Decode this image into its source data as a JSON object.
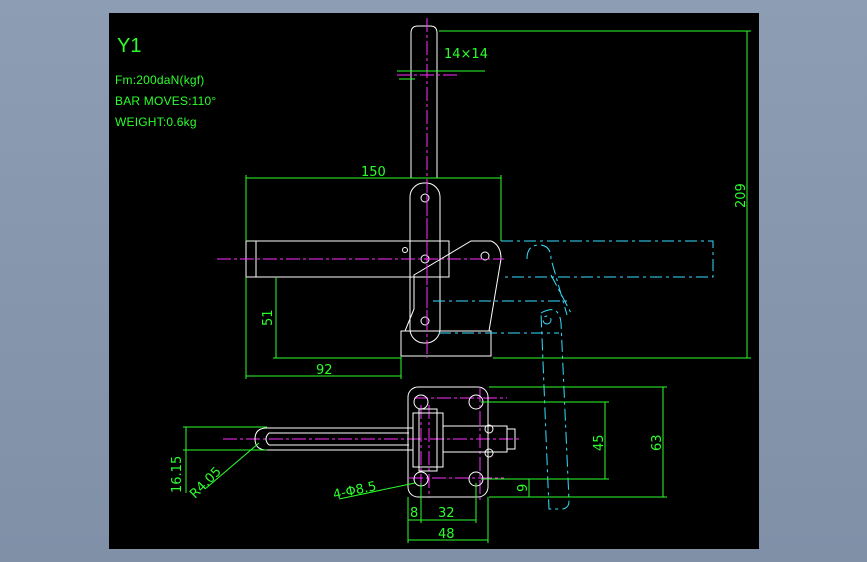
{
  "drawing": {
    "title": "Y1",
    "notes": [
      "Fm:200daN(kgf)",
      "BAR MOVES:110°",
      "WEIGHT:0.6kg"
    ],
    "dimensions": {
      "square": "14×14",
      "width_150": "150",
      "height_209": "209",
      "height_51": "51",
      "width_92": "92",
      "height_45": "45",
      "height_63": "63",
      "height_9": "9",
      "height_1615": "16.15",
      "radius": "R4.05",
      "holes": "4-Φ8.5",
      "width_8": "8",
      "width_32": "32",
      "width_48": "48"
    }
  },
  "colors": {
    "background": "#000000",
    "outline": "#ffffff",
    "dimension": "#2bff2b",
    "centerline": "#ff2bff",
    "ghost": "#33e0ff"
  }
}
